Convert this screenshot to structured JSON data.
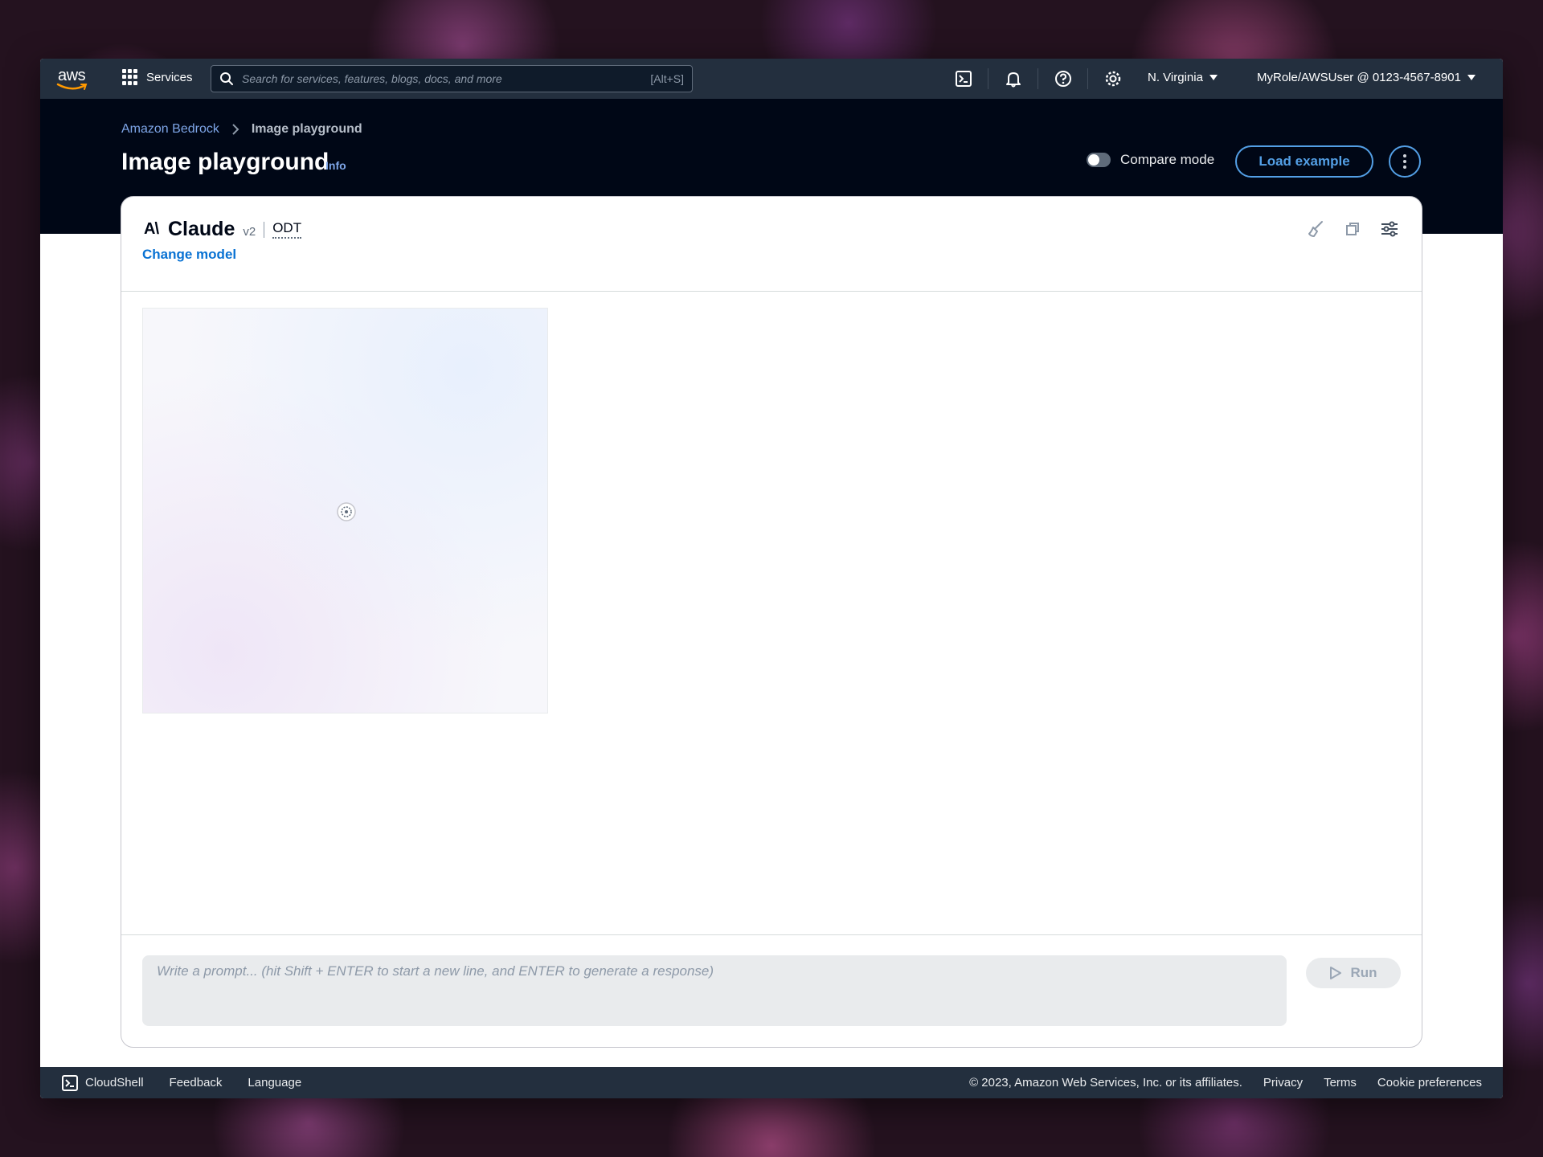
{
  "nav": {
    "logo": "aws",
    "services": "Services",
    "search_placeholder": "Search for services, features, blogs, docs, and more",
    "search_shortcut": "[Alt+S]",
    "icons": [
      "cloudshell-icon",
      "bell-icon",
      "help-icon",
      "gear-icon"
    ],
    "region": "N. Virginia",
    "account": "MyRole/AWSUser @ 0123-4567-8901"
  },
  "header": {
    "breadcrumb": [
      "Amazon Bedrock",
      "Image playground"
    ],
    "title": "Image playground",
    "info": "Info",
    "compare_mode": "Compare mode",
    "load_example": "Load example"
  },
  "card": {
    "provider_logo": "A\\",
    "model_name": "Claude",
    "model_version": "v2",
    "throughput": "ODT",
    "change_model": "Change model",
    "tools": [
      "clear-icon",
      "copy-icon",
      "settings-sliders-icon"
    ],
    "prompt_placeholder": "Write a prompt... (hit Shift + ENTER to start a new line, and ENTER to generate a response)",
    "run": "Run"
  },
  "footer": {
    "cloudshell": "CloudShell",
    "feedback": "Feedback",
    "language": "Language",
    "copyright": "© 2023, Amazon Web Services, Inc. or its affiliates.",
    "privacy": "Privacy",
    "terms": "Terms",
    "cookies": "Cookie preferences"
  },
  "colors": {
    "nav_bg": "#232f3e",
    "header_bg": "#000716",
    "accent": "#539fe5",
    "link": "#0972d3"
  }
}
